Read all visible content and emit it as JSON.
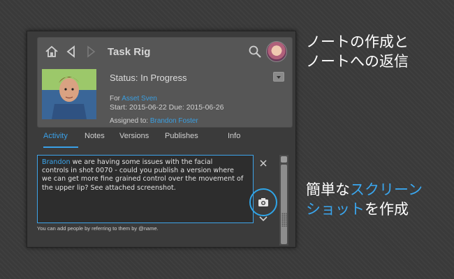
{
  "task": {
    "title": "Task Rig",
    "status": "Status: In Progress",
    "for_label": "For ",
    "for_value": "Asset Sven",
    "dates": "Start: 2015-06-22 Due: 2015-06-26",
    "assigned_label": "Assigned to: ",
    "assigned_value": "Brandon Foster"
  },
  "tabs": [
    {
      "label": "Activity",
      "active": true
    },
    {
      "label": "Notes"
    },
    {
      "label": "Versions"
    },
    {
      "label": "Publishes"
    },
    {
      "label": "Info"
    }
  ],
  "comment": {
    "mention": "Brandon",
    "line1_rest": " we are having some issues with the facial",
    "line2": "controls in shot 0070 - could you publish a version where",
    "line3": "we can get more fine grained control over the movement of",
    "line4": "the upper lip? See attached screenshot.",
    "hint": "You can add people by referring to them by @name."
  },
  "annotations": {
    "top_line1": "ノートの作成と",
    "top_line2": "ノートへの返信",
    "bottom_line1_a": "簡単な",
    "bottom_line1_b": "スクリーン",
    "bottom_line2_a": "ショット",
    "bottom_line2_b": "を作成"
  },
  "colors": {
    "accent": "#3aa0e8",
    "panel": "#3b3b3b",
    "header": "#565656"
  },
  "icons": [
    "home-icon",
    "back-icon",
    "forward-icon",
    "search-icon",
    "avatar",
    "dropdown-icon",
    "close-icon",
    "camera-icon",
    "chevron-down-icon"
  ]
}
